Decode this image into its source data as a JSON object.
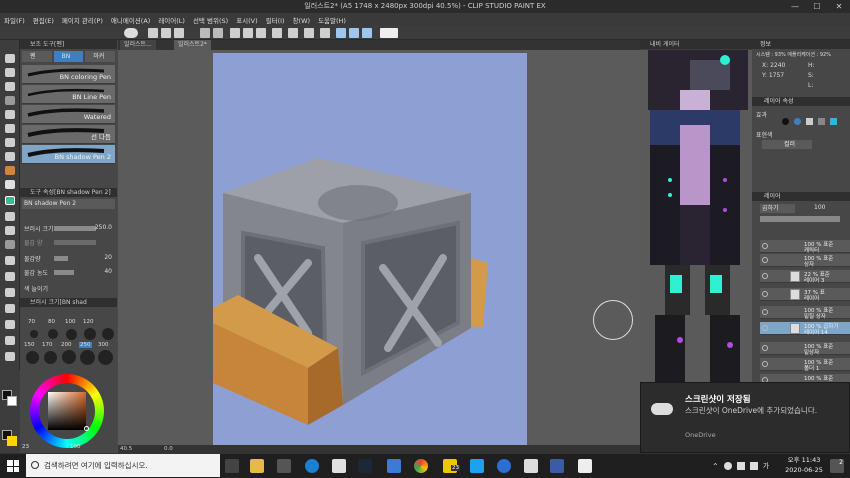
{
  "titlebar": {
    "title": "일러스트2* (A5 1748 x 2480px 300dpi 40.5%) - CLIP STUDIO PAINT EX",
    "minimize": "—",
    "maximize": "☐",
    "close": "✕"
  },
  "menubar": {
    "items": [
      "파일(F)",
      "편집(E)",
      "페이지 관리(P)",
      "애니메이션(A)",
      "레이어(L)",
      "선택 범위(S)",
      "표시(V)",
      "필터(I)",
      "창(W)",
      "도움말(H)"
    ]
  },
  "subtool_panel": {
    "header": "보조 도구[펜]",
    "tabs": [
      "펜",
      "BN",
      "마커"
    ],
    "brushes": [
      "BN coloring Pen",
      "BN Line Pen",
      "Watered",
      "선 다듬",
      "BN shadow Pen 2"
    ]
  },
  "tool_property": {
    "header": "도구 속성[BN shadow Pen 2]",
    "tool_name": "BN shadow Pen 2",
    "rows": [
      {
        "label": "브러시 크기",
        "value": "250.0"
      },
      {
        "label": "물감 양",
        "value": ""
      },
      {
        "label": "물감량",
        "value": "20"
      },
      {
        "label": "물감 농도",
        "value": "40"
      },
      {
        "label": "색 늘이기",
        "value": ""
      }
    ]
  },
  "brush_size_panel": {
    "header": "브러시 크기[BN shad",
    "sizes": [
      "70",
      "80",
      "100",
      "120",
      "150",
      "170",
      "200",
      "250",
      "300"
    ]
  },
  "color_panel": {
    "value_hue": "23",
    "value_sat": "100"
  },
  "canvas_tabs": {
    "tabs": [
      "일러스트...",
      "일러스트2*"
    ]
  },
  "status": {
    "zoom": "40.5",
    "coords": "0.0"
  },
  "navigator": {
    "header": "내비 게이터"
  },
  "info_panel": {
    "header": "정보",
    "x_label": "X:",
    "x": "2240",
    "y_label": "Y:",
    "y": "1757",
    "h_label": "H:",
    "s_label": "S:",
    "l_label": "L:",
    "zoom_info": "시스템 : 93%   애플리케이션 : 92%"
  },
  "layer_props": {
    "header": "레이어 속성",
    "effect_label": "효과",
    "expression_label": "표현색",
    "expression_value": "컬러"
  },
  "layer_panel": {
    "header": "레이어",
    "blend": "곱하기",
    "opacity": "100",
    "layers": [
      {
        "line1": "100 % 표준",
        "line2": "캐릭터"
      },
      {
        "line1": "100 % 표준",
        "line2": "상자"
      },
      {
        "line1": "22 % 표준",
        "line2": "레이어 3"
      },
      {
        "line1": "37 % 표",
        "line2": "레이어"
      },
      {
        "line1": "100 % 표준",
        "line2": "밑칠 상자"
      },
      {
        "line1": "100 % 곱하기",
        "line2": "레이어 14"
      },
      {
        "line1": "100 % 표준",
        "line2": "밑상자"
      },
      {
        "line1": "100 % 표준",
        "line2": "폴더 1"
      },
      {
        "line1": "100 % 표준",
        "line2": ""
      }
    ]
  },
  "toast": {
    "title": "스크린샷이 저장됨",
    "body": "스크린샷이 OneDrive에 추가되었습니다.",
    "app": "OneDrive"
  },
  "taskbar": {
    "search_placeholder": "검색하려면 여기에 입력하십시오.",
    "badge": "23",
    "time": "오후 11:43",
    "date": "2020-06-25",
    "notif_count": "2",
    "ime": "가"
  },
  "colors": {
    "canvas_bg": "#8e9fd4",
    "accent": "#3f7fbf",
    "cube": "#8c8f96",
    "wood": "#c88a45"
  }
}
